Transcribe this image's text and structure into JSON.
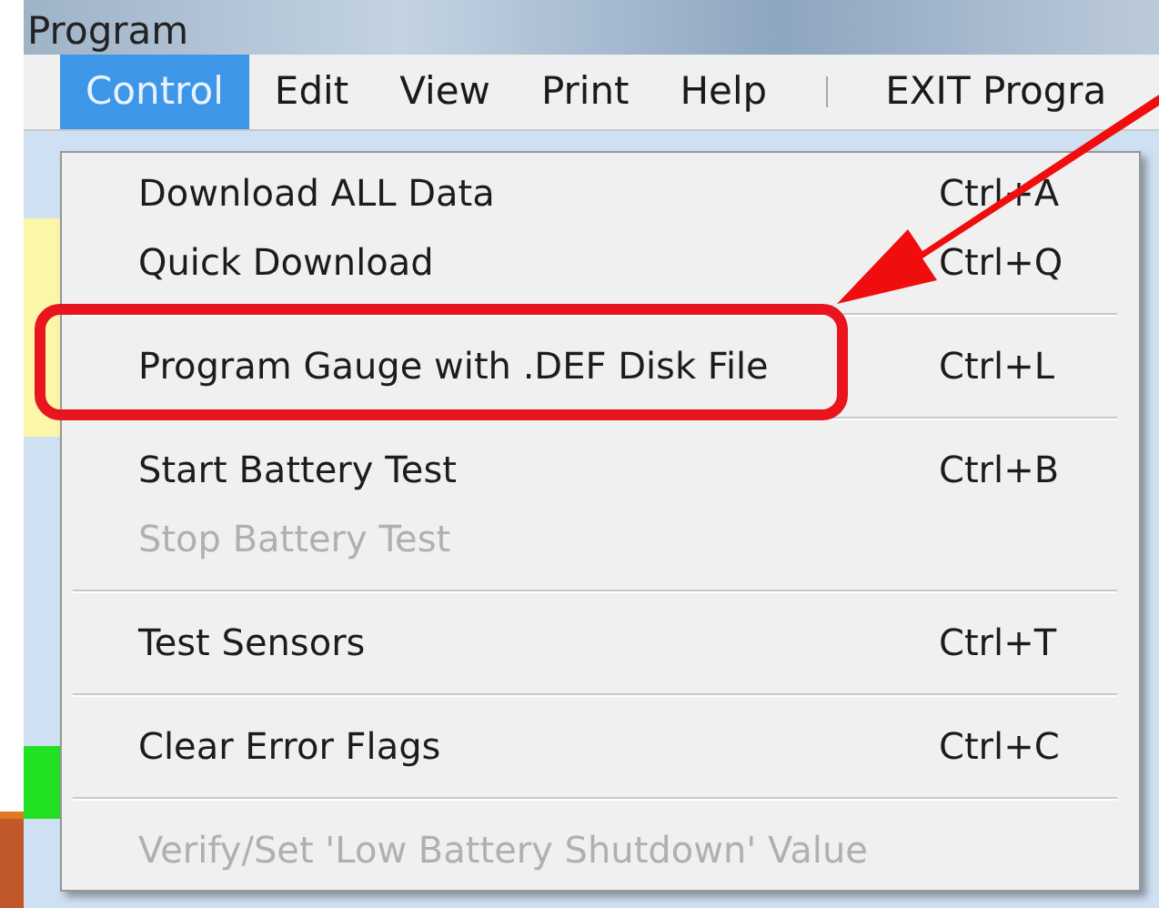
{
  "window": {
    "title": "Program"
  },
  "menu_bar": [
    {
      "label": "Control",
      "selected": true
    },
    {
      "label": "Edit",
      "selected": false
    },
    {
      "label": "View",
      "selected": false
    },
    {
      "label": "Print",
      "selected": false
    },
    {
      "label": "Help",
      "selected": false
    },
    {
      "label": "EXIT Progra",
      "selected": false,
      "separator_before": true
    }
  ],
  "menu": {
    "groups": [
      [
        {
          "label": "Download ALL Data",
          "shortcut": "Ctrl+A",
          "disabled": false,
          "highlighted": false
        },
        {
          "label": "Quick Download",
          "shortcut": "Ctrl+Q",
          "disabled": false,
          "highlighted": false
        }
      ],
      [
        {
          "label": "Program Gauge with .DEF Disk File",
          "shortcut": "Ctrl+L",
          "disabled": false,
          "highlighted": true
        }
      ],
      [
        {
          "label": "Start Battery Test",
          "shortcut": "Ctrl+B",
          "disabled": false,
          "highlighted": false
        },
        {
          "label": "Stop Battery Test",
          "disabled": true,
          "highlighted": false
        }
      ],
      [
        {
          "label": "Test Sensors",
          "shortcut": "Ctrl+T",
          "disabled": false,
          "highlighted": false
        }
      ],
      [
        {
          "label": "Clear Error Flags",
          "shortcut": "Ctrl+C",
          "disabled": false,
          "highlighted": false
        }
      ],
      [
        {
          "label": "Verify/Set 'Low Battery Shutdown' Value",
          "disabled": true,
          "highlighted": false
        }
      ]
    ]
  }
}
